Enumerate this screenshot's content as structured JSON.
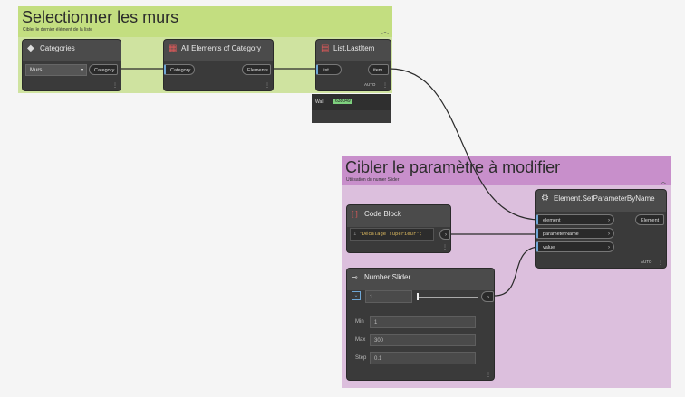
{
  "group1": {
    "title": "Selectionner les murs",
    "subtitle": "Cibler le dernier élément de la liste",
    "color": "#c3de80"
  },
  "group2": {
    "title": "Cibler le paramètre à modifier",
    "subtitle": "Utilisation du numer Slider",
    "color": "#c88fcb",
    "body_color": "#dcbfdd"
  },
  "categories": {
    "title": "Categories",
    "icon": "categories-icon",
    "selected": "Murs",
    "output": "Category"
  },
  "allElements": {
    "title": "All Elements of Category",
    "icon": "elements-icon",
    "input": "Category",
    "output": "Elements"
  },
  "lastItem": {
    "title": "List.LastItem",
    "icon": "list-icon",
    "input": "list",
    "output": "item",
    "lacing": "AUTO"
  },
  "preview": {
    "label": "Wall",
    "value": "638049"
  },
  "setParam": {
    "title": "Element.SetParameterByName",
    "icon": "set-parameter-icon",
    "inputs": [
      "element",
      "parameterName",
      "value"
    ],
    "output": "Element",
    "lacing": "AUTO"
  },
  "codeBlock": {
    "title": "Code Block",
    "icon": "code-block-icon",
    "line_no": "1",
    "code": "\"Décalage supérieur\";"
  },
  "slider": {
    "title": "Number Slider",
    "icon": "slider-icon",
    "value": "1",
    "min_label": "Min",
    "min": "1",
    "max_label": "Max",
    "max": "300",
    "step_label": "Step",
    "step": "0.1",
    "position": 0.0
  }
}
